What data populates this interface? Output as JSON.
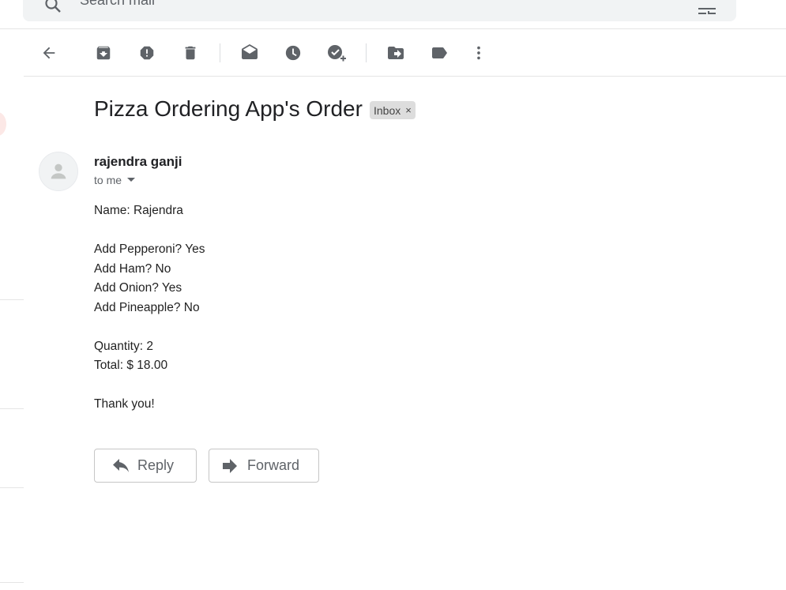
{
  "search": {
    "placeholder": "Search mail"
  },
  "toolbar": {
    "icons": [
      "back-arrow-icon",
      "archive-icon",
      "report-spam-icon",
      "delete-icon",
      "mark-unread-icon",
      "snooze-icon",
      "add-task-icon",
      "move-to-icon",
      "label-icon",
      "more-vert-icon"
    ]
  },
  "email": {
    "subject": "Pizza Ordering App's Order",
    "label": "Inbox",
    "label_remove": "×",
    "sender": "rajendra ganji",
    "recipients": "to me",
    "body": {
      "name": "Name: Rajendra",
      "pepperoni": "Add Pepperoni? Yes",
      "ham": "Add Ham? No",
      "onion": "Add Onion? Yes",
      "pineapple": "Add Pineapple? No",
      "quantity": "Quantity: 2",
      "total": "Total: $ 18.00",
      "thanks": "Thank you!"
    }
  },
  "actions": {
    "reply_label": "Reply",
    "forward_label": "Forward"
  },
  "colors": {
    "icon": "#5f6368",
    "search_bg": "#f1f3f4",
    "chip_bg": "#dddddd"
  }
}
